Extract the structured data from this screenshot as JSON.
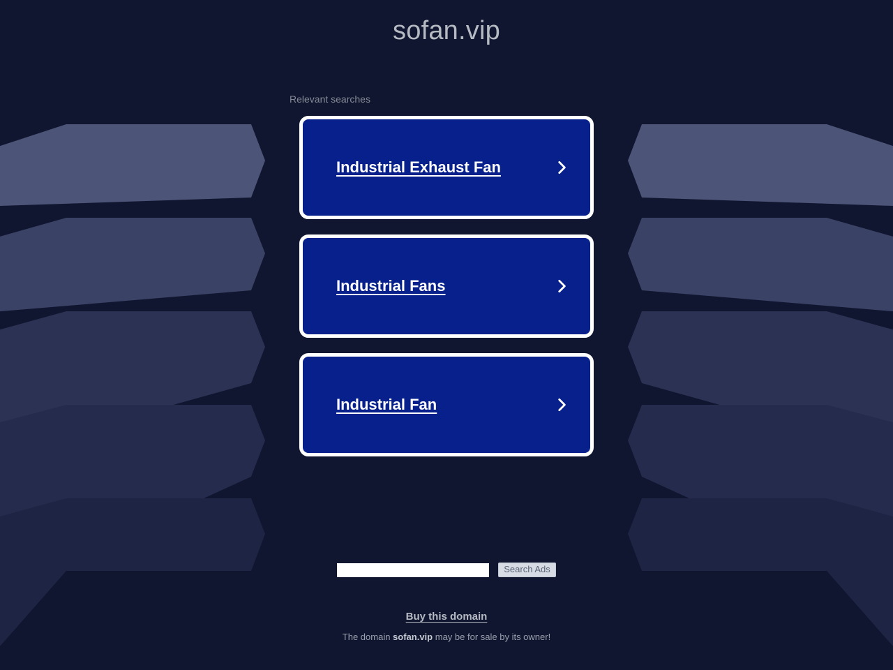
{
  "page": {
    "title": "sofan.vip",
    "background_color": "#111630",
    "accent_color": "#07208c"
  },
  "relevant": {
    "label": "Relevant searches"
  },
  "ads": [
    {
      "title": "Industrial Exhaust Fan",
      "chevron": "chevron-right-icon"
    },
    {
      "title": "Industrial Fans",
      "chevron": "chevron-right-icon"
    },
    {
      "title": "Industrial Fan",
      "chevron": "chevron-right-icon"
    }
  ],
  "search": {
    "value": "",
    "placeholder": "",
    "button_label": "Search Ads"
  },
  "footer": {
    "buy_link": "Buy this domain",
    "note_prefix": "The domain ",
    "note_domain": "sofan.vip",
    "note_suffix": " may be for sale by its owner!"
  },
  "decor": {
    "name": "hexagon-pattern",
    "colors": [
      "#4c5578",
      "#3a4266",
      "#2b3254",
      "#242b4c",
      "#1e2444"
    ]
  }
}
